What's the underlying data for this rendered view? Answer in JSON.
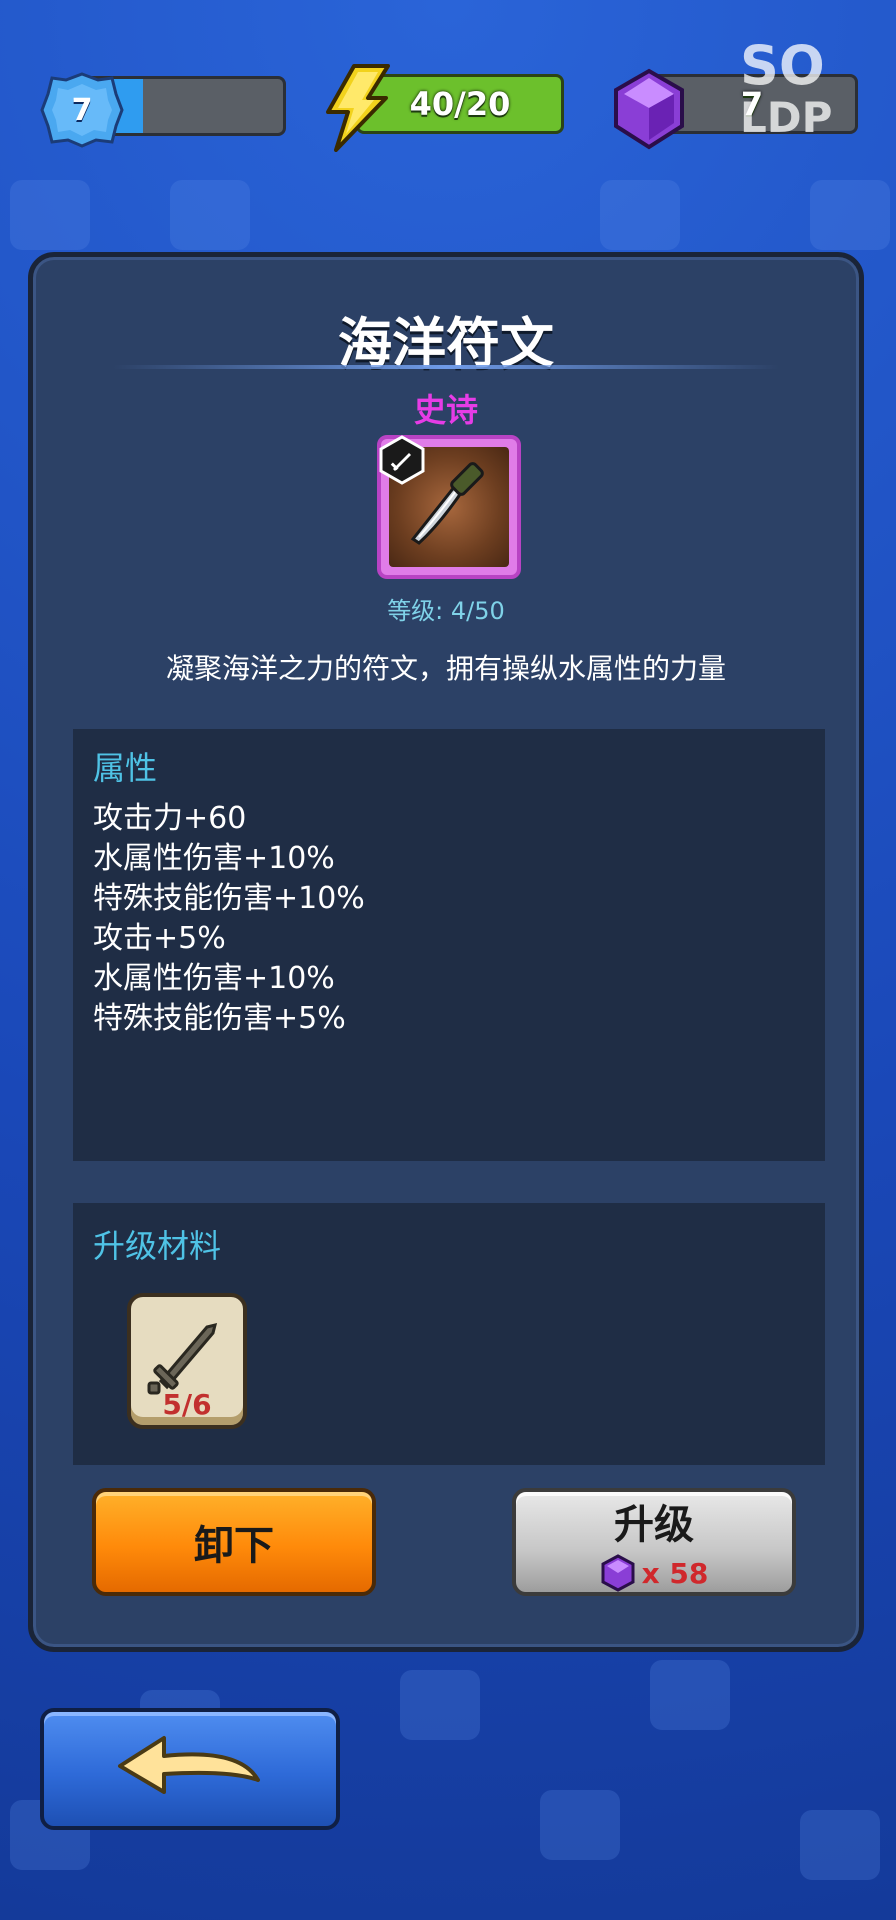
{
  "top_bar": {
    "level": "7",
    "level_progress": 0.3,
    "energy": "40/20",
    "gems": "7",
    "watermark_line1": "SO",
    "watermark_line2": "LDP"
  },
  "item": {
    "name": "海洋符文",
    "rarity": "史诗",
    "level_label": "等级: 4/50",
    "description": "凝聚海洋之力的符文，拥有操纵水属性的力量"
  },
  "attributes": {
    "title": "属性",
    "lines": [
      "攻击力+60",
      "水属性伤害+10%",
      "特殊技能伤害+10%",
      "攻击+5%",
      "水属性伤害+10%",
      "特殊技能伤害+5%"
    ]
  },
  "materials": {
    "title": "升级材料",
    "count": "5/6"
  },
  "buttons": {
    "unequip": "卸下",
    "upgrade": "升级",
    "upgrade_cost": "x 58"
  },
  "colors": {
    "rarity_epic": "#e63ce6",
    "section_title": "#4fc3e6",
    "energy_fill": "#6cc02c",
    "xp_fill": "#2f9cf0"
  },
  "icons": {
    "level_badge": "blue-gear-badge",
    "energy": "lightning-bolt-icon",
    "gem": "purple-gem-icon",
    "item": "dagger-icon",
    "material": "sword-icon",
    "back": "back-arrow-icon"
  }
}
